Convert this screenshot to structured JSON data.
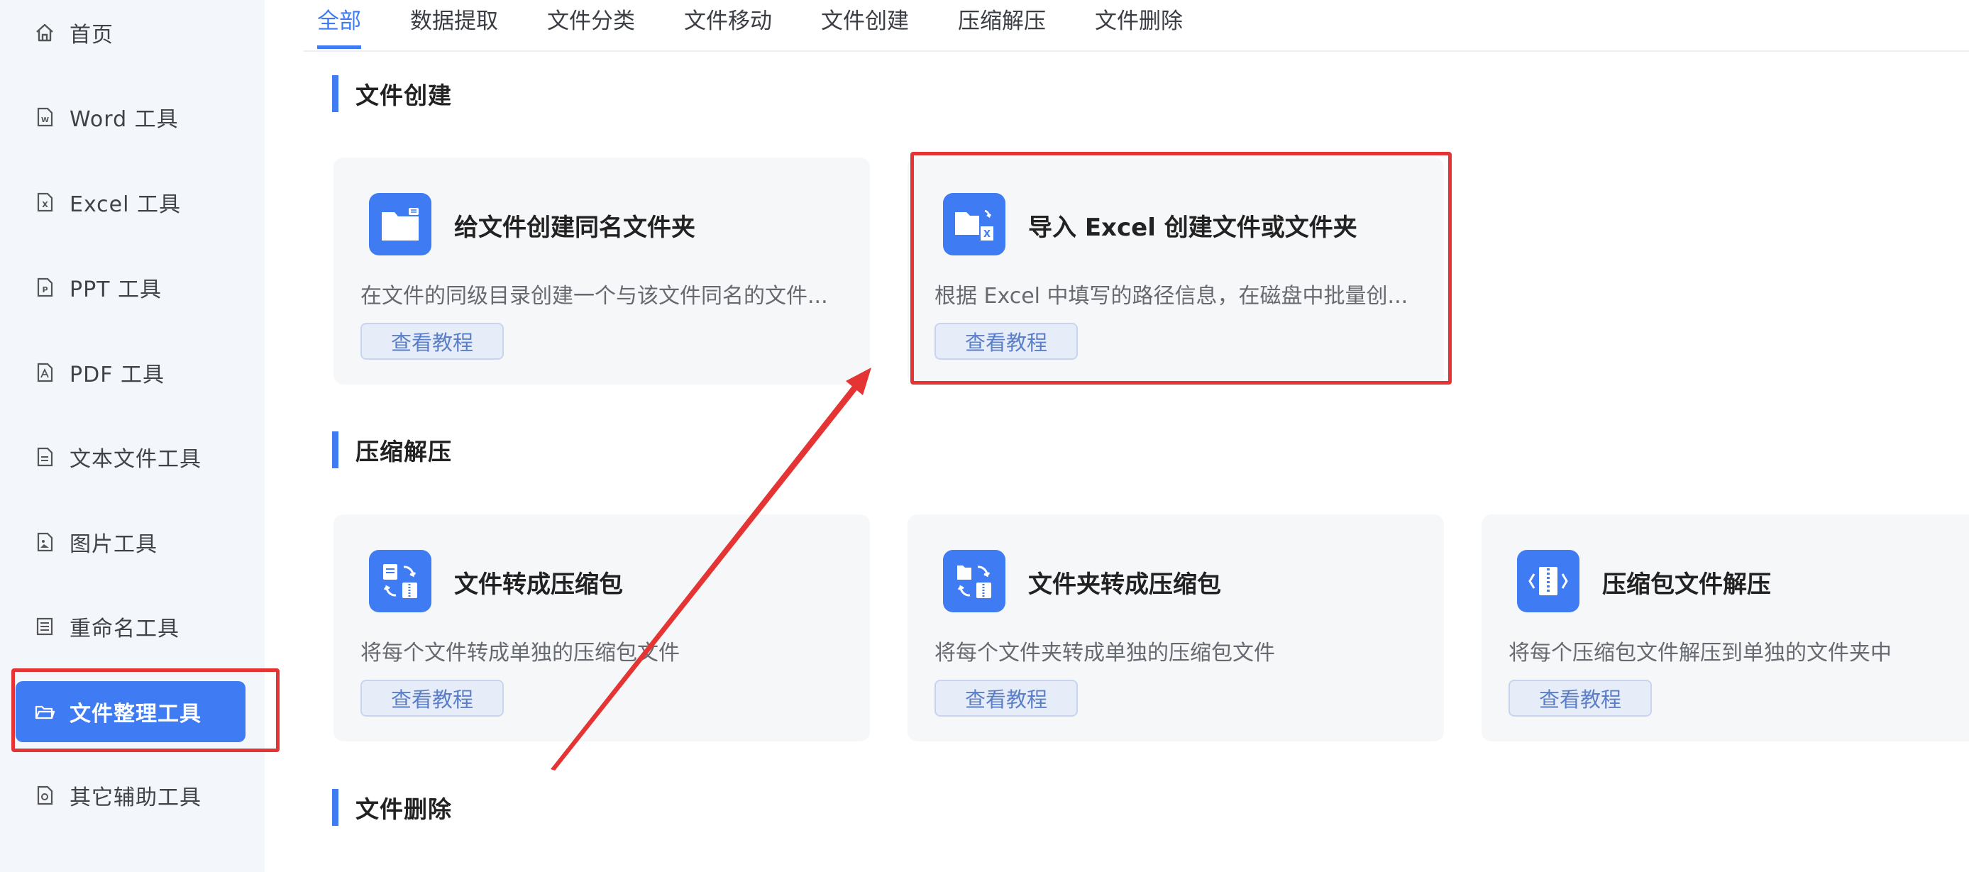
{
  "sidebar": {
    "items": [
      {
        "label": "首页",
        "icon": "home-icon"
      },
      {
        "label": "Word 工具",
        "icon": "word-file-icon"
      },
      {
        "label": "Excel 工具",
        "icon": "excel-file-icon"
      },
      {
        "label": "PPT 工具",
        "icon": "ppt-file-icon"
      },
      {
        "label": "PDF 工具",
        "icon": "pdf-file-icon"
      },
      {
        "label": "文本文件工具",
        "icon": "text-file-icon"
      },
      {
        "label": "图片工具",
        "icon": "image-file-icon"
      },
      {
        "label": "重命名工具",
        "icon": "rename-icon"
      },
      {
        "label": "文件整理工具",
        "icon": "folder-open-icon",
        "active": true
      },
      {
        "label": "其它辅助工具",
        "icon": "tools-icon"
      }
    ]
  },
  "tabs": [
    "全部",
    "数据提取",
    "文件分类",
    "文件移动",
    "文件创建",
    "压缩解压",
    "文件删除"
  ],
  "active_tab": "全部",
  "sections": [
    {
      "title": "文件创建",
      "cards": [
        {
          "title": "给文件创建同名文件夹",
          "desc": "在文件的同级目录创建一个与该文件同名的文件...",
          "button": "查看教程",
          "icon": "folder-create-icon"
        },
        {
          "title": "导入 Excel 创建文件或文件夹",
          "desc": "根据 Excel 中填写的路径信息，在磁盘中批量创...",
          "button": "查看教程",
          "icon": "folder-excel-icon",
          "highlighted": true
        }
      ]
    },
    {
      "title": "压缩解压",
      "cards": [
        {
          "title": "文件转成压缩包",
          "desc": "将每个文件转成单独的压缩包文件",
          "button": "查看教程",
          "icon": "file-to-zip-icon"
        },
        {
          "title": "文件夹转成压缩包",
          "desc": "将每个文件夹转成单独的压缩包文件",
          "button": "查看教程",
          "icon": "folder-to-zip-icon"
        },
        {
          "title": "压缩包文件解压",
          "desc": "将每个压缩包文件解压到单独的文件夹中",
          "button": "查看教程",
          "icon": "unzip-icon"
        }
      ]
    },
    {
      "title": "文件删除",
      "cards": []
    }
  ],
  "colors": {
    "accent": "#3f7cf3",
    "sidebar_bg": "#f3f6fb",
    "card_bg": "#f6f7f9",
    "annotation_red": "#e53434"
  }
}
